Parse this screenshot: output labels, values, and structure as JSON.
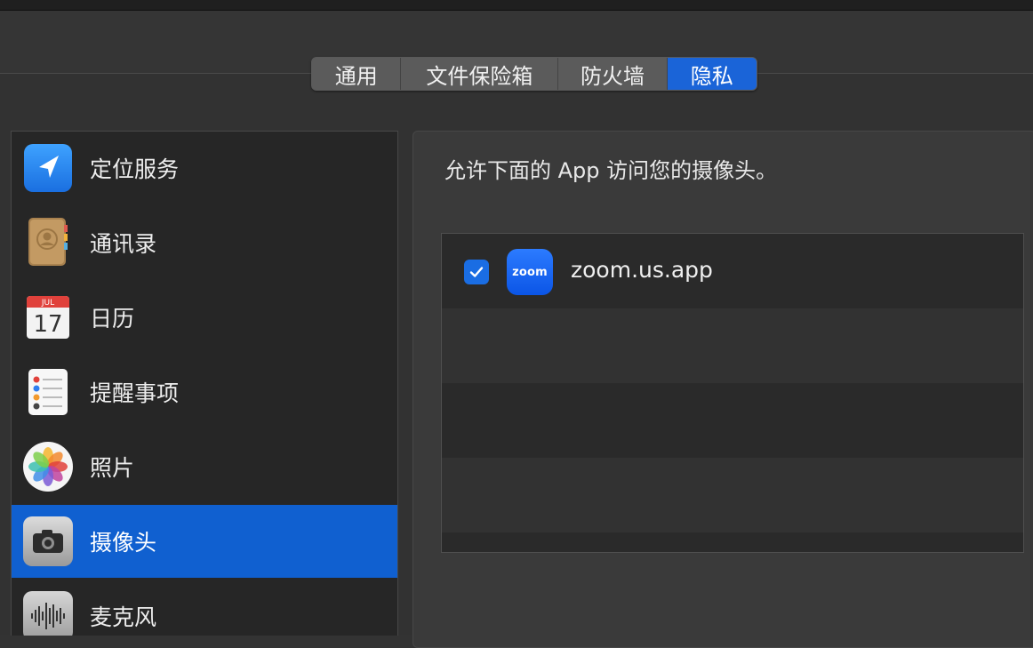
{
  "tabs": [
    {
      "label": "通用",
      "active": false
    },
    {
      "label": "文件保险箱",
      "active": false
    },
    {
      "label": "防火墙",
      "active": false
    },
    {
      "label": "隐私",
      "active": true
    }
  ],
  "sidebar": {
    "items": [
      {
        "label": "定位服务",
        "icon": "location-services-icon"
      },
      {
        "label": "通讯录",
        "icon": "contacts-icon"
      },
      {
        "label": "日历",
        "icon": "calendar-icon",
        "calendar_month": "JUL",
        "calendar_day": "17"
      },
      {
        "label": "提醒事项",
        "icon": "reminders-icon"
      },
      {
        "label": "照片",
        "icon": "photos-icon"
      },
      {
        "label": "摄像头",
        "icon": "camera-icon",
        "selected": true
      },
      {
        "label": "麦克风",
        "icon": "microphone-icon"
      }
    ]
  },
  "panel": {
    "description": "允许下面的 App 访问您的摄像头。",
    "apps": [
      {
        "name": "zoom.us.app",
        "icon_text": "zoom",
        "checked": true
      }
    ]
  },
  "colors": {
    "accent": "#1060d0",
    "checkbox": "#1a6de3"
  }
}
